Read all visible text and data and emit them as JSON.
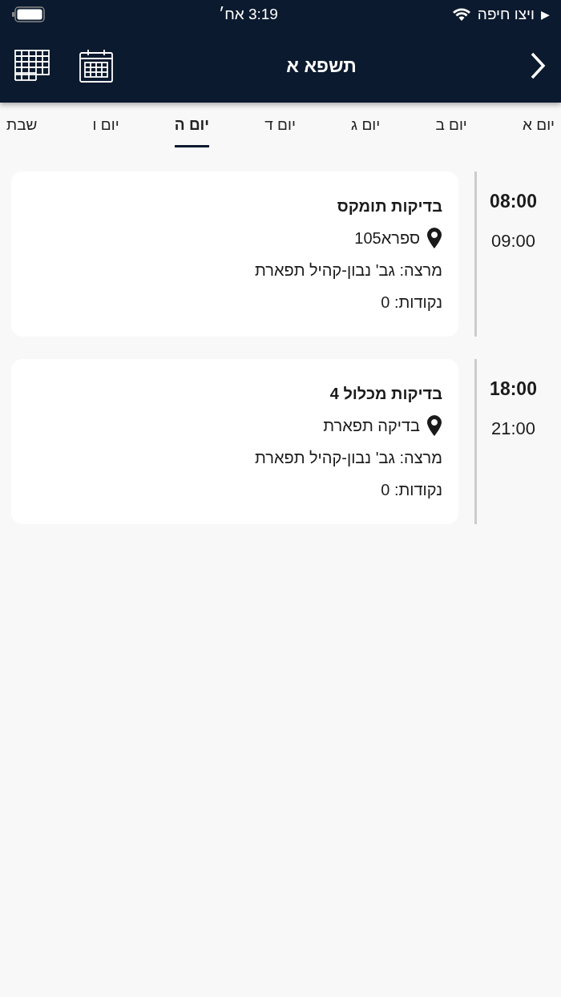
{
  "status_bar": {
    "back_arrow": "▶",
    "carrier": "ויצו חיפה",
    "time": "3:19 אח׳"
  },
  "header": {
    "title": "תשפא א"
  },
  "tabs": [
    {
      "label": "יום א",
      "selected": false
    },
    {
      "label": "יום ב",
      "selected": false
    },
    {
      "label": "יום ג",
      "selected": false
    },
    {
      "label": "יום ד",
      "selected": false
    },
    {
      "label": "יום ה",
      "selected": true
    },
    {
      "label": "יום ו",
      "selected": false
    },
    {
      "label": "שבת",
      "selected": false
    }
  ],
  "events": [
    {
      "start": "08:00",
      "end": "09:00",
      "title": "בדיקות תומקס",
      "location": "ספרא105",
      "lecturer": "מרצה: גב' נבון-קהיל תפארת",
      "points": "נקודות: 0"
    },
    {
      "start": "18:00",
      "end": "21:00",
      "title": "בדיקות מכלול 4",
      "location": "בדיקה תפארת",
      "lecturer": "מרצה: גב' נבון-קהיל תפארת",
      "points": "נקודות: 0"
    }
  ]
}
